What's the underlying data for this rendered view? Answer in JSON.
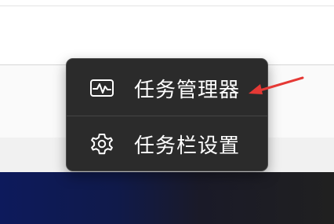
{
  "context_menu": {
    "items": [
      {
        "label": "任务管理器",
        "icon": "activity-monitor-icon"
      },
      {
        "label": "任务栏设置",
        "icon": "gear-icon"
      }
    ]
  },
  "colors": {
    "menu_background": "#2b2b2b",
    "menu_text": "#ffffff",
    "annotation_arrow": "#e53935",
    "taskbar_start": "#0d1a5c",
    "taskbar_end": "#202020"
  }
}
